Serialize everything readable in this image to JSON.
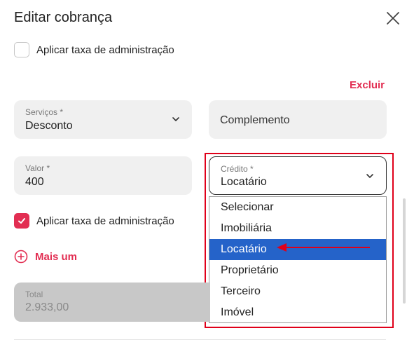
{
  "header": {
    "title": "Editar cobrança"
  },
  "top_checkbox": {
    "label": "Aplicar taxa de administração",
    "checked": false
  },
  "excluir_label": "Excluir",
  "servicos": {
    "label": "Serviços *",
    "value": "Desconto"
  },
  "complemento": {
    "placeholder": "Complemento"
  },
  "valor": {
    "label": "Valor *",
    "value": "400"
  },
  "credito": {
    "label": "Crédito *",
    "value": "Locatário",
    "options": [
      "Selecionar",
      "Imobiliária",
      "Locatário",
      "Proprietário",
      "Terceiro",
      "Imóvel"
    ],
    "selected": "Locatário"
  },
  "admin_checkbox": {
    "label": "Aplicar taxa de administração",
    "checked": true
  },
  "mais_um_label": "Mais um",
  "total": {
    "label": "Total",
    "value": "2.933,00"
  },
  "colors": {
    "accent": "#e22e52",
    "selection": "#2563c9",
    "annotation": "#e0001a"
  }
}
